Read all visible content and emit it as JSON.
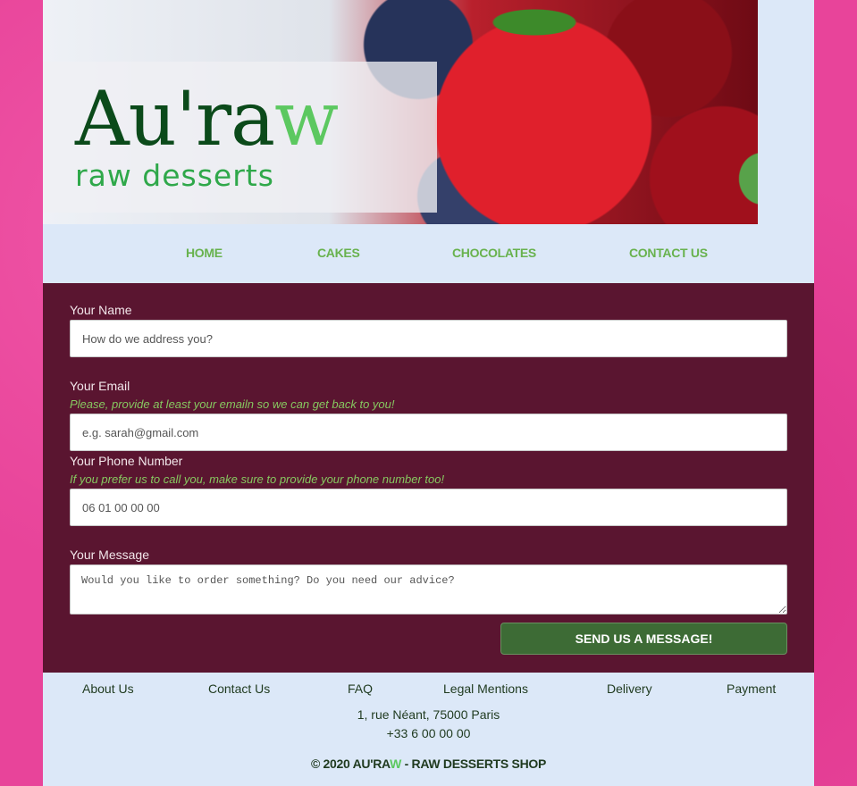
{
  "colors": {
    "page_bg": "#e8449a",
    "panel_bg": "#dce8f8",
    "form_bg": "#5a1530",
    "nav_link": "#68b24e",
    "hint": "#86c860",
    "button": "#3d6b35",
    "logo_dark": "#0b4a1a",
    "logo_accent": "#5cc860"
  },
  "header": {
    "logo_main": "Au'ra",
    "logo_accent": "w",
    "logo_sub": "raw desserts"
  },
  "nav": {
    "items": [
      {
        "label": "HOME"
      },
      {
        "label": "CAKES"
      },
      {
        "label": "CHOCOLATES"
      },
      {
        "label": "CONTACT US"
      }
    ]
  },
  "form": {
    "name": {
      "label": "Your Name",
      "placeholder": "How do we address you?"
    },
    "email": {
      "label": "Your Email",
      "hint": "Please, provide at least your emailn so we can get back to you!",
      "placeholder": "e.g. sarah@gmail.com"
    },
    "phone": {
      "label": "Your Phone Number",
      "hint": "If you prefer us to call you, make sure to provide your phone number too!",
      "placeholder": "06 01 00 00 00"
    },
    "message": {
      "label": "Your Message",
      "placeholder": "Would you like to order something? Do you need our advice?"
    },
    "submit_label": "SEND US A MESSAGE!"
  },
  "footer": {
    "links": [
      {
        "label": "About Us"
      },
      {
        "label": "Contact Us"
      },
      {
        "label": "FAQ"
      },
      {
        "label": "Legal Mentions"
      },
      {
        "label": "Delivery"
      },
      {
        "label": "Payment"
      }
    ],
    "address": "1, rue Néant, 75000 Paris",
    "phone": "+33 6 00 00 00",
    "copyright_prefix": "© 2020 AU'RA",
    "copyright_accent": "W",
    "copyright_suffix": " - RAW DESSERTS SHOP"
  }
}
